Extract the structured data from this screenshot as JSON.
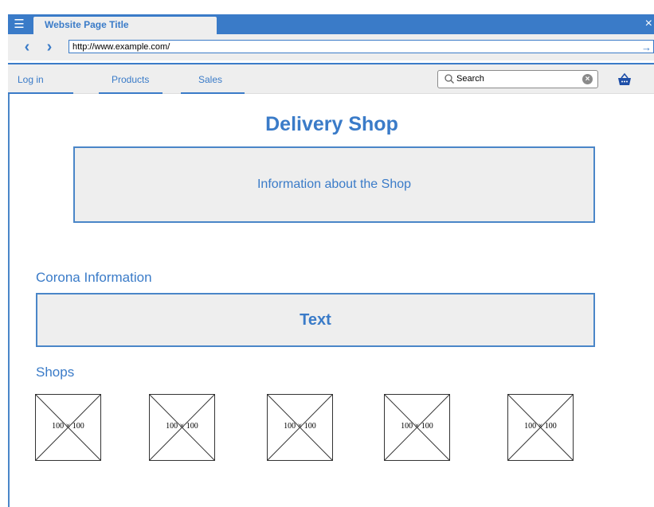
{
  "window": {
    "title": "Website Page Title",
    "url": "http://www.example.com/"
  },
  "nav": {
    "items": [
      {
        "label": "Log in"
      },
      {
        "label": "Products"
      },
      {
        "label": "Sales"
      }
    ],
    "search_value": "Search"
  },
  "page": {
    "title": "Delivery Shop",
    "info_text": "Information about the Shop",
    "corona_heading": "Corona Information",
    "corona_text": "Text",
    "shops_heading": "Shops",
    "shops": [
      {
        "label": "100 × 100"
      },
      {
        "label": "100 × 100"
      },
      {
        "label": "100 × 100"
      },
      {
        "label": "100 × 100"
      },
      {
        "label": "100 × 100"
      }
    ]
  },
  "colors": {
    "accent": "#3a7bc8",
    "panel": "#eeeeee"
  },
  "icons": [
    "menu-icon",
    "close-icon",
    "chevron-left-icon",
    "chevron-right-icon",
    "arrow-right-icon",
    "search-icon",
    "clear-icon",
    "basket-icon"
  ]
}
